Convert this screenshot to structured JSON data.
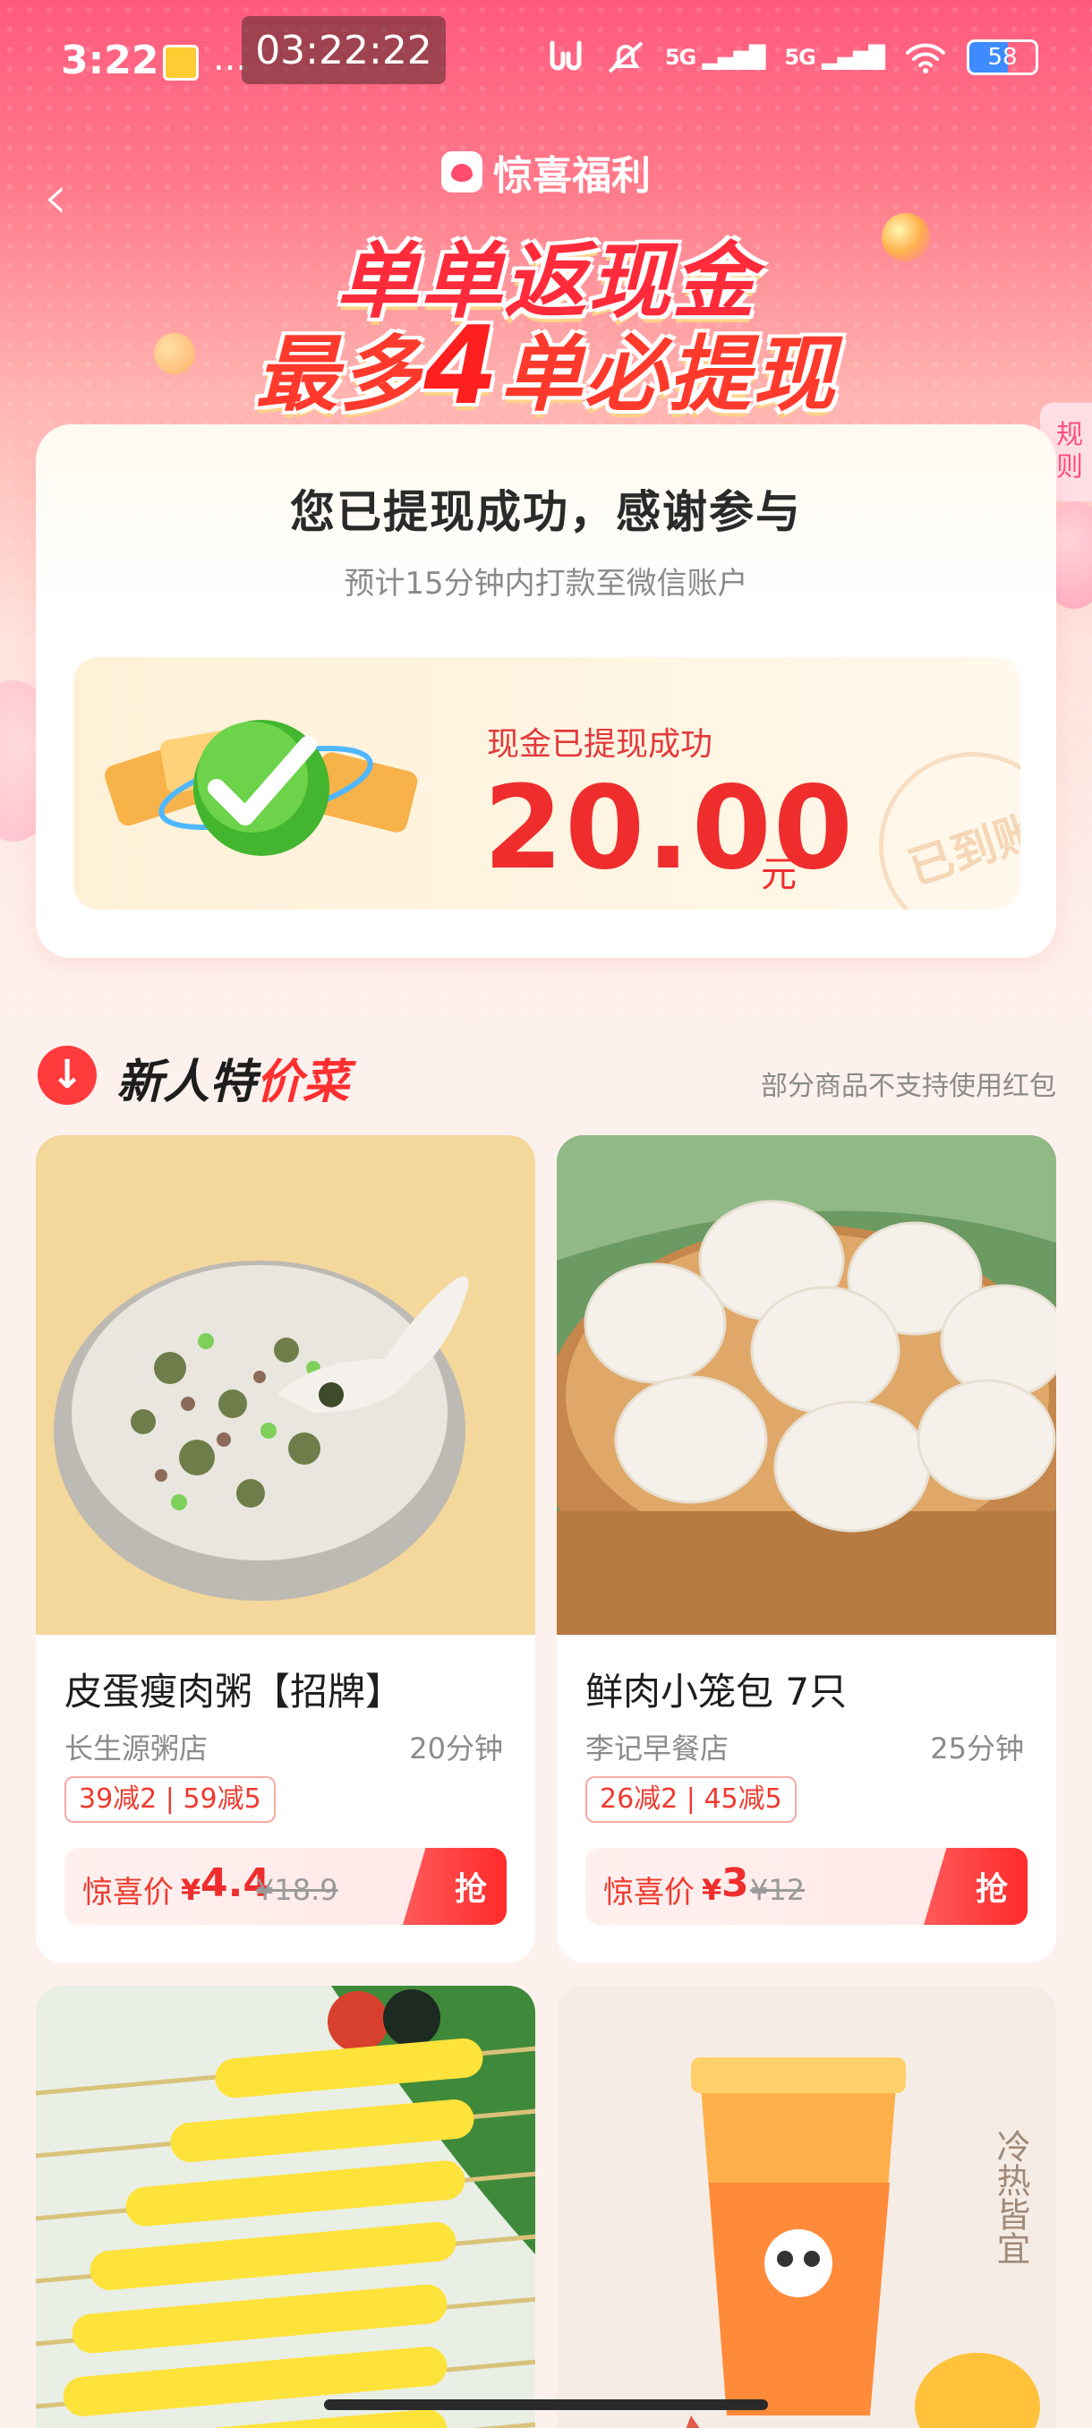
{
  "status_bar": {
    "time": "3:22",
    "recording_timer": "03:22:22",
    "dots": "...",
    "network_1": "5G",
    "network_2": "5G",
    "battery": "58"
  },
  "header": {
    "brand": "惊喜福利",
    "headline_line1": "单单返现金",
    "headline_line2_a": "最多",
    "headline_line2_num": "4",
    "headline_line2_b": "单必提现",
    "rules_label": "规则"
  },
  "success_card": {
    "title": "您已提现成功，感谢参与",
    "subtitle": "预计15分钟内打款至微信账户",
    "cash_label": "现金已提现成功",
    "amount": "20.00",
    "unit": "元",
    "stamp": "已到账"
  },
  "section": {
    "title_a": "新人特",
    "title_b": "价菜",
    "note": "部分商品不支持使用红包"
  },
  "products": [
    {
      "name": "皮蛋瘦肉粥【招牌】",
      "shop": "长生源粥店",
      "time": "20分钟",
      "discount": "39减2 | 59减5",
      "price_label": "惊喜价",
      "currency": "¥",
      "price": "4.4",
      "original": "¥18.9",
      "button": "抢"
    },
    {
      "name": "鲜肉小笼包 7只",
      "shop": "李记早餐店",
      "time": "25分钟",
      "discount": "26减2 | 45减5",
      "price_label": "惊喜价",
      "currency": "¥",
      "price": "3",
      "original": "¥12",
      "button": "抢"
    }
  ],
  "product_4_image_text": "冷热皆宜",
  "colors": {
    "accent_red": "#ef2d2d",
    "hero_pink": "#ff5a7e",
    "card_bg": "#ffffff"
  }
}
